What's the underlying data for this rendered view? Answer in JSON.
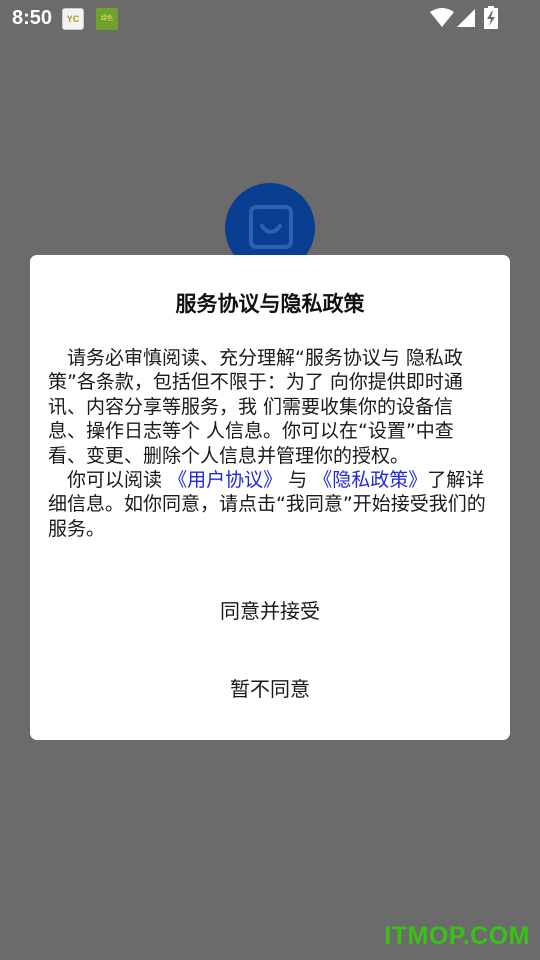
{
  "status_bar": {
    "time": "8:50",
    "notification_icons": [
      "yc-app-icon",
      "green-app-icon"
    ],
    "notif1_text": "YC",
    "notif2_text": "绿色"
  },
  "dialog": {
    "title": "服务协议与隐私政策",
    "paragraph1": "请务必审慎阅读、充分理解“服务协议与 隐私政策”各条款，包括但不限于：为了 向你提供即时通讯、内容分享等服务，我 们需要收集你的设备信息、操作日志等个 人信息。你可以在“设置”中查看、变更、删除个人信息并管理你的授权。",
    "paragraph2_before": "你可以阅读",
    "user_agreement_link": "《用户协议》",
    "paragraph2_middle": "与",
    "privacy_policy_link": "《隐私政策》",
    "paragraph2_after": "了解详细信息。如你同意，请点击“我同意”开始接受我们的服务。",
    "agree_button": "同意并接受",
    "decline_button": "暂不同意"
  },
  "watermark": "ITMOP.COM",
  "colors": {
    "overlay": "#6b6b6b",
    "dialog_bg": "#ffffff",
    "link": "#2029d8",
    "logo_bg": "#0a3e91",
    "watermark": "#39c216"
  }
}
